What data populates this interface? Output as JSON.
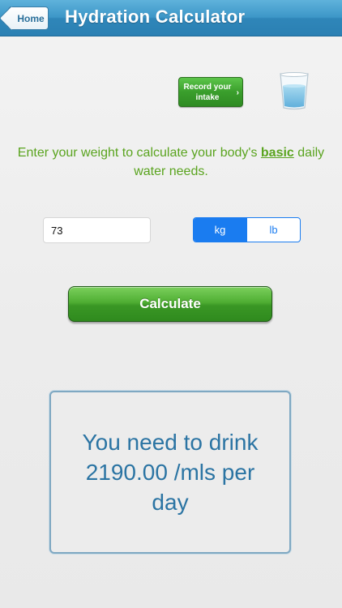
{
  "navbar": {
    "back_label": "Home",
    "title": "Hydration Calculator"
  },
  "record": {
    "label": "Record your intake"
  },
  "instruction": {
    "before": "Enter your weight to calculate your body's ",
    "emphasis": "basic",
    "after": " daily water needs."
  },
  "weight": {
    "value": "73"
  },
  "units": {
    "options": [
      "kg",
      "lb"
    ],
    "selected": "kg"
  },
  "calculate": {
    "label": "Calculate"
  },
  "result": {
    "text": "You need to drink 2190.00 /mls per day"
  },
  "colors": {
    "header_blue": "#3d97c8",
    "accent_green": "#5aa41f",
    "segment_blue": "#1a7cf0",
    "result_text": "#2b74a3"
  },
  "icons": {
    "glass": "water-glass-icon",
    "chevron": "chevron-right-icon"
  }
}
